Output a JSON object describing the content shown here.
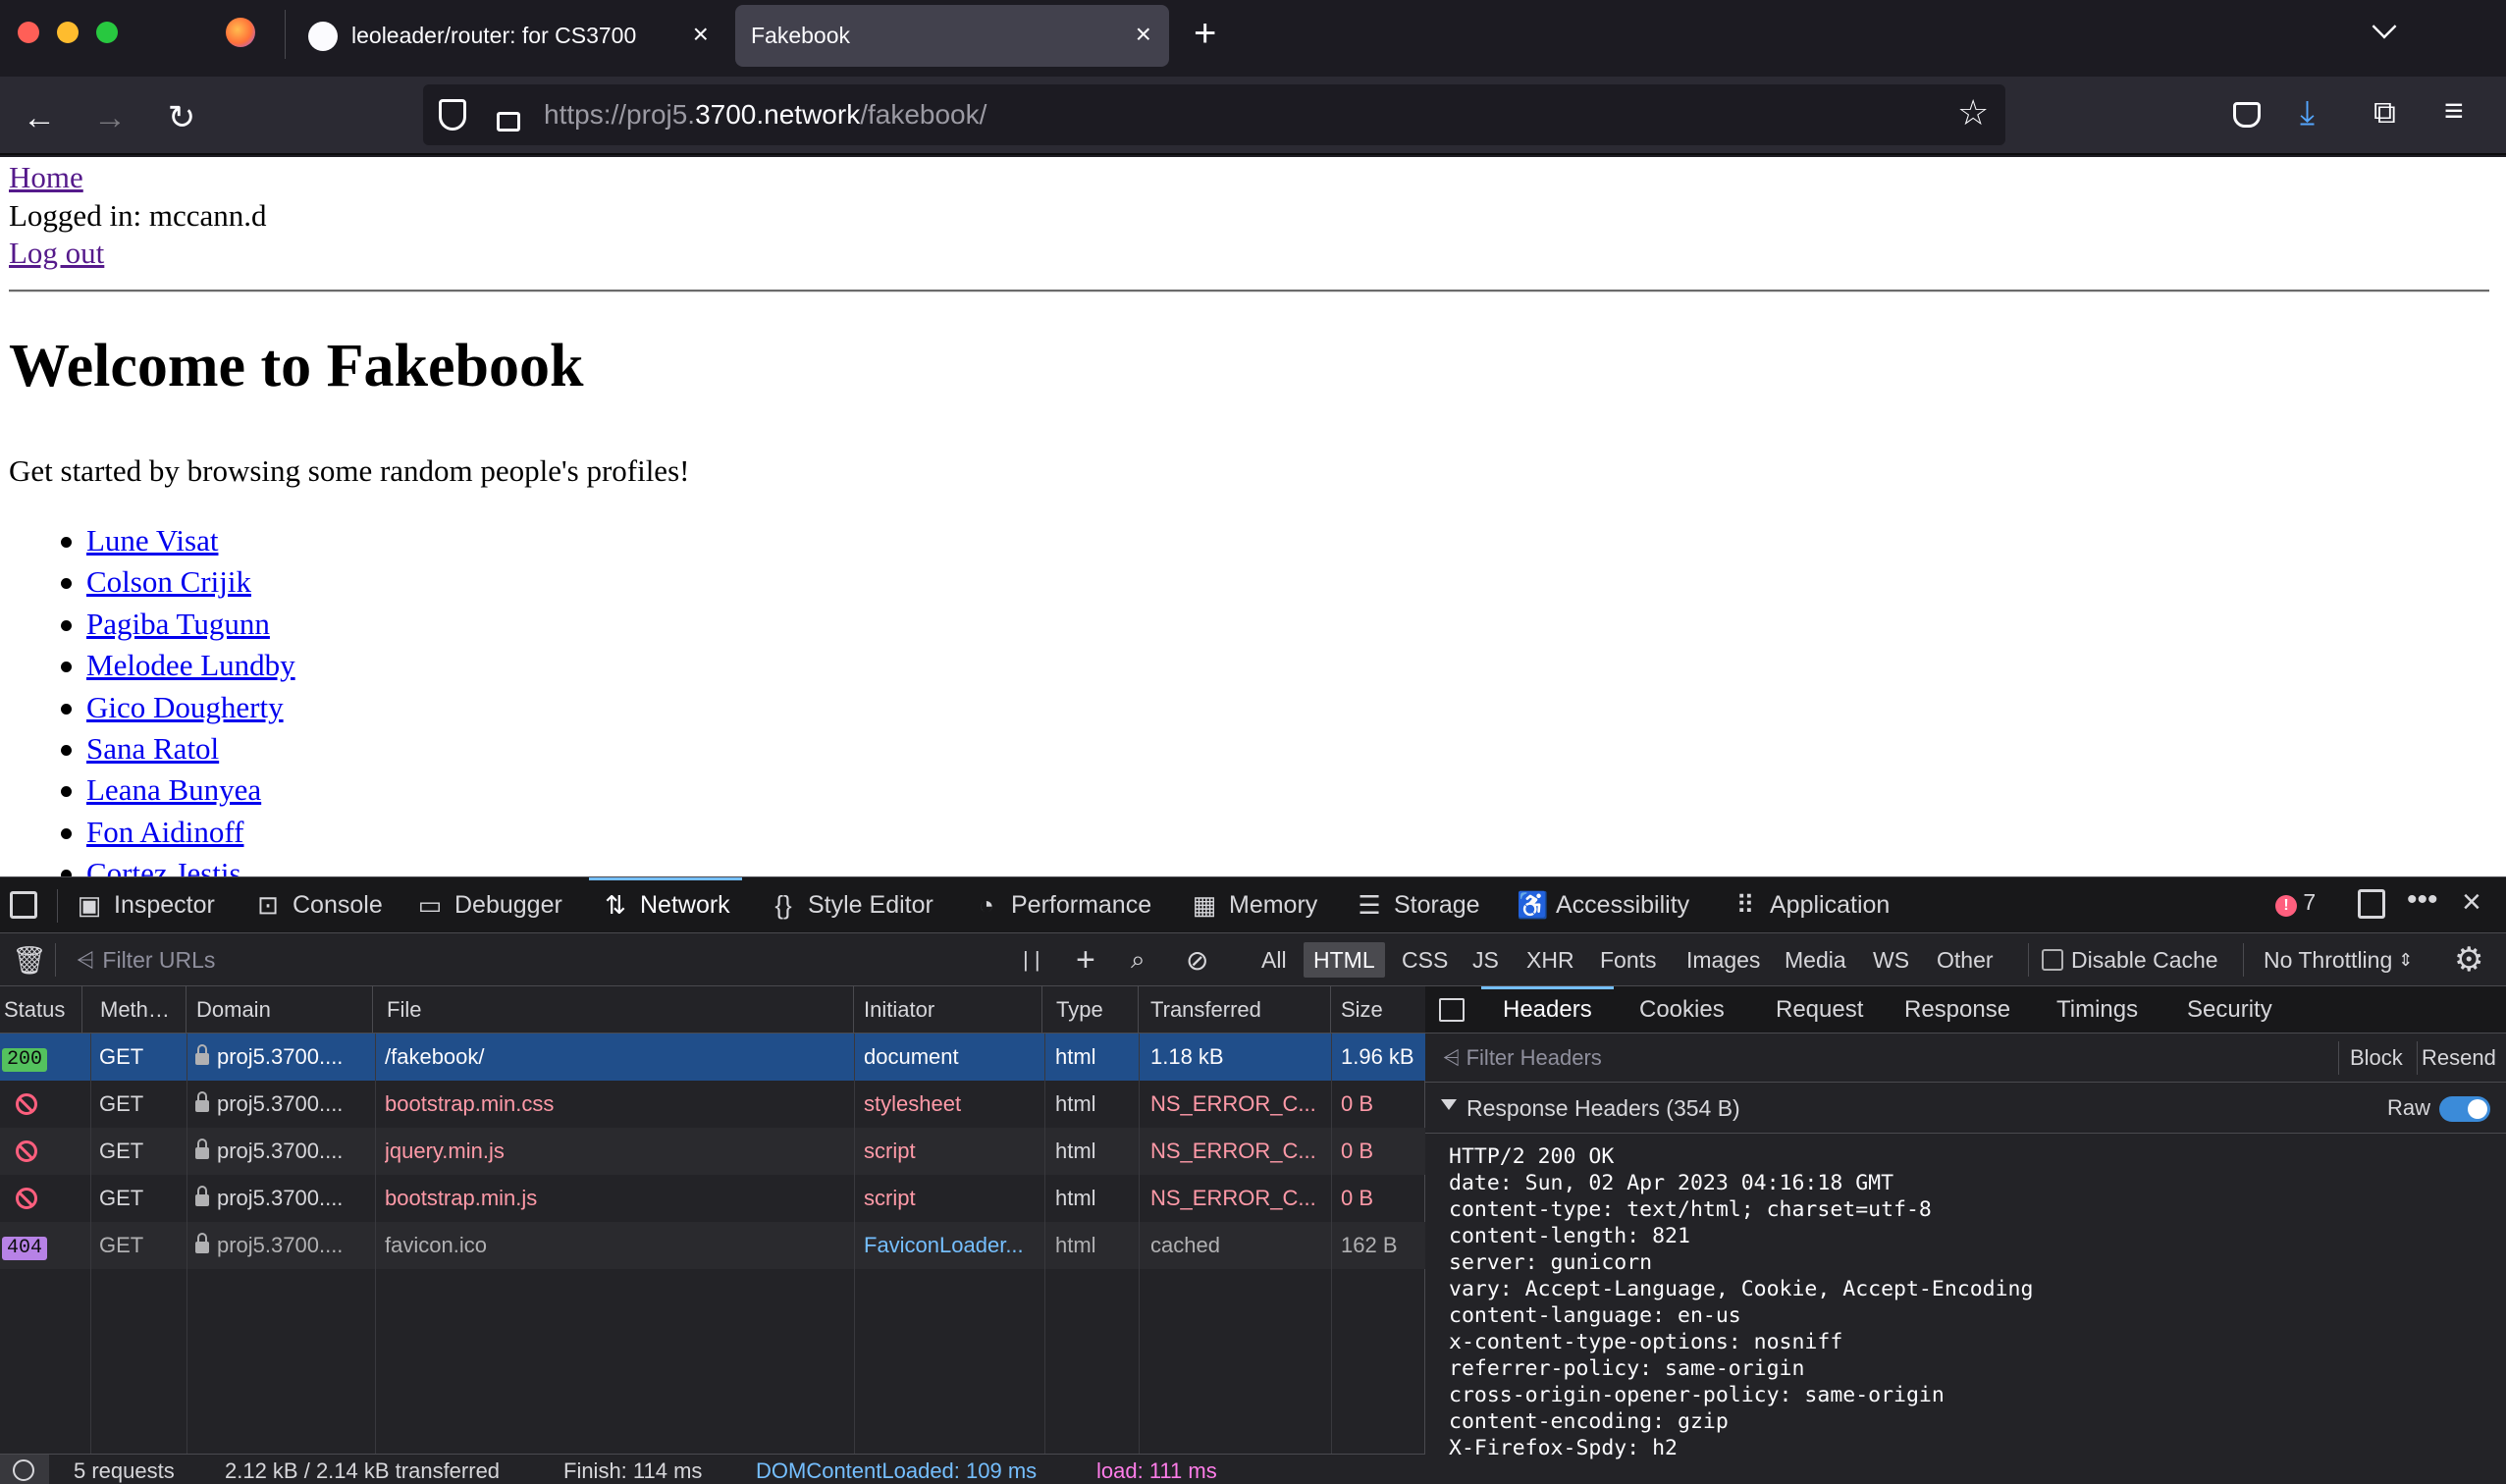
{
  "browser": {
    "tabs": [
      {
        "label": "leoleader/router: for CS3700"
      },
      {
        "label": "Fakebook"
      }
    ],
    "url": {
      "prefix": "https://proj5.",
      "host": "3700.network",
      "path": "/fakebook/"
    }
  },
  "page": {
    "home_link": "Home",
    "logged_in": "Logged in: mccann.d",
    "logout_link": "Log out",
    "heading": "Welcome to Fakebook",
    "intro": "Get started by browsing some random people's profiles!",
    "profiles": [
      "Lune Visat",
      "Colson Crijik",
      "Pagiba Tugunn",
      "Melodee Lundby",
      "Gico Dougherty",
      "Sana Ratol",
      "Leana Bunyea",
      "Fon Aidinoff",
      "Cortez Jestis"
    ]
  },
  "devtools": {
    "tabs": [
      "Inspector",
      "Console",
      "Debugger",
      "Network",
      "Style Editor",
      "Performance",
      "Memory",
      "Storage",
      "Accessibility",
      "Application"
    ],
    "active_tab": "Network",
    "error_count": "7",
    "network_toolbar": {
      "filter_placeholder": "Filter URLs",
      "type_filters": [
        "All",
        "HTML",
        "CSS",
        "JS",
        "XHR",
        "Fonts",
        "Images",
        "Media",
        "WS",
        "Other"
      ],
      "active_filter": "HTML",
      "disable_cache": "Disable Cache",
      "throttling": "No Throttling"
    },
    "columns": [
      "Status",
      "Meth…",
      "Domain",
      "File",
      "Initiator",
      "Type",
      "Transferred",
      "Size"
    ],
    "requests": [
      {
        "status": "200",
        "method": "GET",
        "domain": "proj5.3700....",
        "file": "/fakebook/",
        "initiator": "document",
        "type": "html",
        "transferred": "1.18 kB",
        "size": "1.96 kB"
      },
      {
        "status": "blocked",
        "method": "GET",
        "domain": "proj5.3700....",
        "file": "bootstrap.min.css",
        "initiator": "stylesheet",
        "type": "html",
        "transferred": "NS_ERROR_C...",
        "size": "0 B"
      },
      {
        "status": "blocked",
        "method": "GET",
        "domain": "proj5.3700....",
        "file": "jquery.min.js",
        "initiator": "script",
        "type": "html",
        "transferred": "NS_ERROR_C...",
        "size": "0 B"
      },
      {
        "status": "blocked",
        "method": "GET",
        "domain": "proj5.3700....",
        "file": "bootstrap.min.js",
        "initiator": "script",
        "type": "html",
        "transferred": "NS_ERROR_C...",
        "size": "0 B"
      },
      {
        "status": "404",
        "method": "GET",
        "domain": "proj5.3700....",
        "file": "favicon.ico",
        "initiator": "FaviconLoader...",
        "type": "html",
        "transferred": "cached",
        "size": "162 B"
      }
    ],
    "summary": {
      "requests": "5 requests",
      "transferred": "2.12 kB / 2.14 kB transferred",
      "finish": "Finish: 114 ms",
      "dom": "DOMContentLoaded: 109 ms",
      "load": "load: 111 ms"
    },
    "details": {
      "tabs": [
        "Headers",
        "Cookies",
        "Request",
        "Response",
        "Timings",
        "Security"
      ],
      "active_tab": "Headers",
      "filter_placeholder": "Filter Headers",
      "block": "Block",
      "resend": "Resend",
      "section": "Response Headers (354 B)",
      "raw_label": "Raw",
      "raw_headers": "HTTP/2 200 OK\ndate: Sun, 02 Apr 2023 04:16:18 GMT\ncontent-type: text/html; charset=utf-8\ncontent-length: 821\nserver: gunicorn\nvary: Accept-Language, Cookie, Accept-Encoding\ncontent-language: en-us\nx-content-type-options: nosniff\nreferrer-policy: same-origin\ncross-origin-opener-policy: same-origin\ncontent-encoding: gzip\nX-Firefox-Spdy: h2"
    }
  },
  "colors": {
    "status_200": "#54c25e",
    "status_404": "#b782e6",
    "selected_row": "#204e8a",
    "accent": "#75bfff",
    "blocked": "#ff5f7e"
  }
}
